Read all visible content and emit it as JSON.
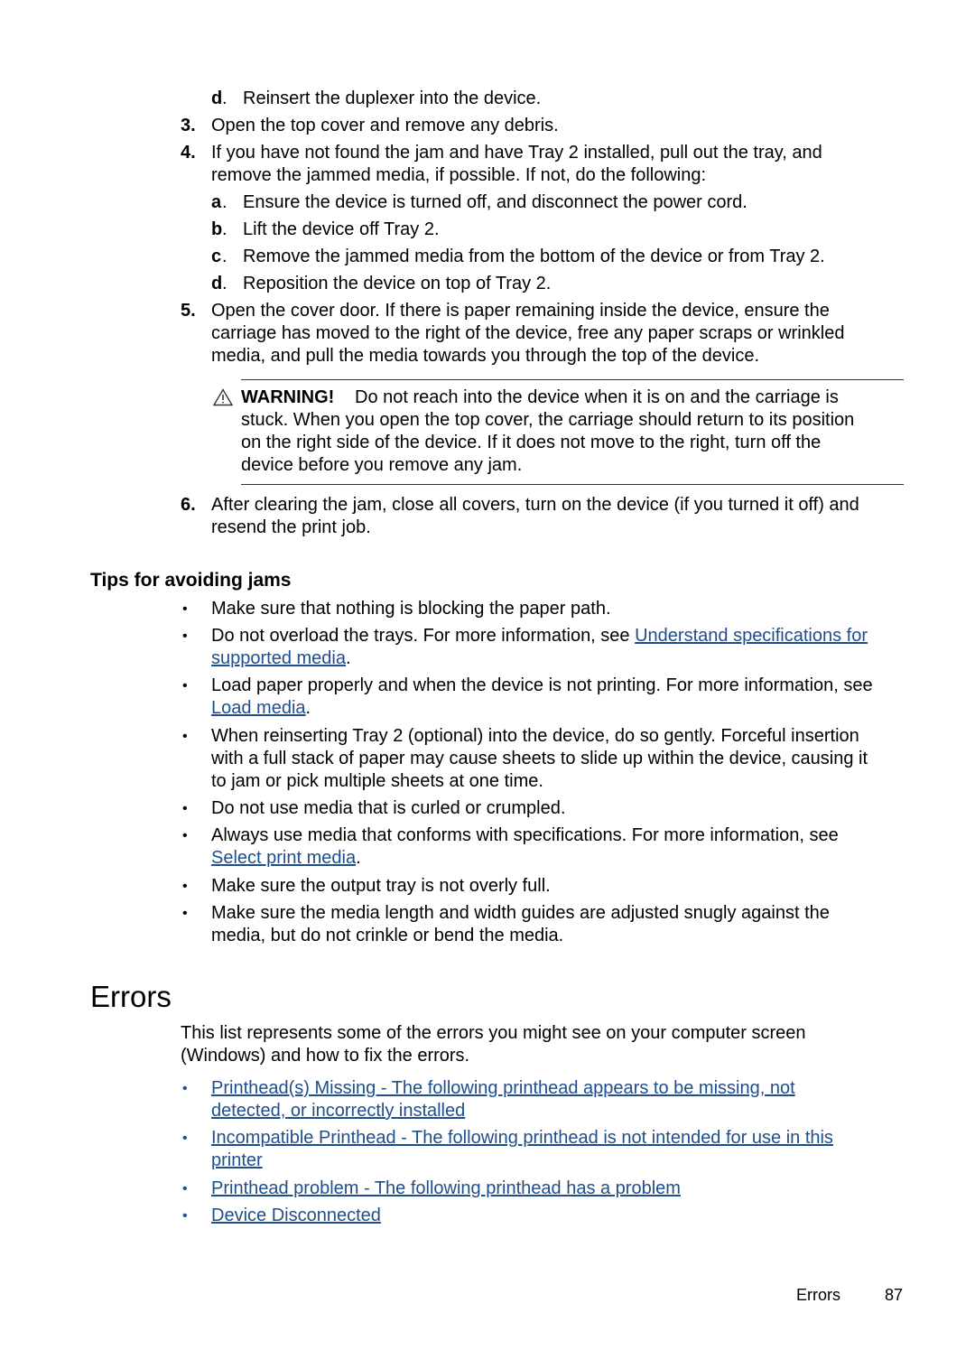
{
  "steps": {
    "step3_sub_d": {
      "marker": "d",
      "text": "Reinsert the duplexer into the device."
    },
    "step3": {
      "marker": "3.",
      "text": "Open the top cover and remove any debris."
    },
    "step4": {
      "marker": "4.",
      "lines": [
        "If you have not found the jam and have Tray 2 installed, pull out the tray, and",
        "remove the jammed media, if possible. If not, do the following:"
      ],
      "substeps": [
        {
          "marker": "a",
          "text": "Ensure the device is turned off, and disconnect the power cord."
        },
        {
          "marker": "b",
          "text": "Lift the device off Tray 2."
        },
        {
          "marker": "c",
          "text": "Remove the jammed media from the bottom of the device or from Tray 2."
        },
        {
          "marker": "d",
          "text": "Reposition the device on top of Tray 2."
        }
      ]
    },
    "step5": {
      "marker": "5.",
      "lines": [
        "Open the cover door. If there is paper remaining inside the device, ensure the",
        "carriage has moved to the right of the device, free any paper scraps or wrinkled",
        "media, and pull the media towards you through the top of the device."
      ]
    },
    "warning": {
      "icon": "warning-triangle-icon",
      "label": "WARNING!",
      "lines": [
        "Do not reach into the device when it is on and the carriage is",
        "stuck. When you open the top cover, the carriage should return to its position",
        "on the right side of the device. If it does not move to the right, turn off the",
        "device before you remove any jam."
      ]
    },
    "step6": {
      "marker": "6.",
      "lines": [
        "After clearing the jam, close all covers, turn on the device (if you turned it off) and",
        "resend the print job."
      ]
    }
  },
  "tips": {
    "heading": "Tips for avoiding jams",
    "bullet": "•",
    "items": [
      {
        "text": "Make sure that nothing is blocking the paper path."
      },
      {
        "text": "Do not overload the trays. For more information, see ",
        "link1": "Understand specifications for",
        "link2": "supported media",
        "after": "."
      },
      {
        "text": "Load paper properly and when the device is not printing. For more information, see",
        "link": "Load media",
        "after": "."
      },
      {
        "lines": [
          "When reinserting Tray 2 (optional) into the device, do so gently. Forceful insertion",
          "with a full stack of paper may cause sheets to slide up within the device, causing it",
          "to jam or pick multiple sheets at one time."
        ]
      },
      {
        "text": "Do not use media that is curled or crumpled."
      },
      {
        "text": "Always use media that conforms with specifications. For more information, see",
        "link": "Select print media",
        "after": "."
      },
      {
        "text": "Make sure the output tray is not overly full."
      },
      {
        "lines": [
          "Make sure the media length and width guides are adjusted snugly against the",
          "media, but do not crinkle or bend the media."
        ]
      }
    ]
  },
  "errors": {
    "heading": "Errors",
    "intro": [
      "This list represents some of the errors you might see on your computer screen",
      "(Windows) and how to fix the errors."
    ],
    "links": [
      {
        "lines": [
          "Printhead(s) Missing - The following printhead appears to be missing, not",
          "detected, or incorrectly installed"
        ]
      },
      {
        "lines": [
          "Incompatible Printhead - The following printhead is not intended for use in this",
          "printer"
        ]
      },
      {
        "lines": [
          "Printhead problem - The following printhead has a problem"
        ]
      },
      {
        "lines": [
          "Device Disconnected"
        ]
      }
    ]
  },
  "footer": {
    "section": "Errors",
    "page_number": "87"
  },
  "colors": {
    "link": "#1f4e8c",
    "text": "#000000"
  }
}
